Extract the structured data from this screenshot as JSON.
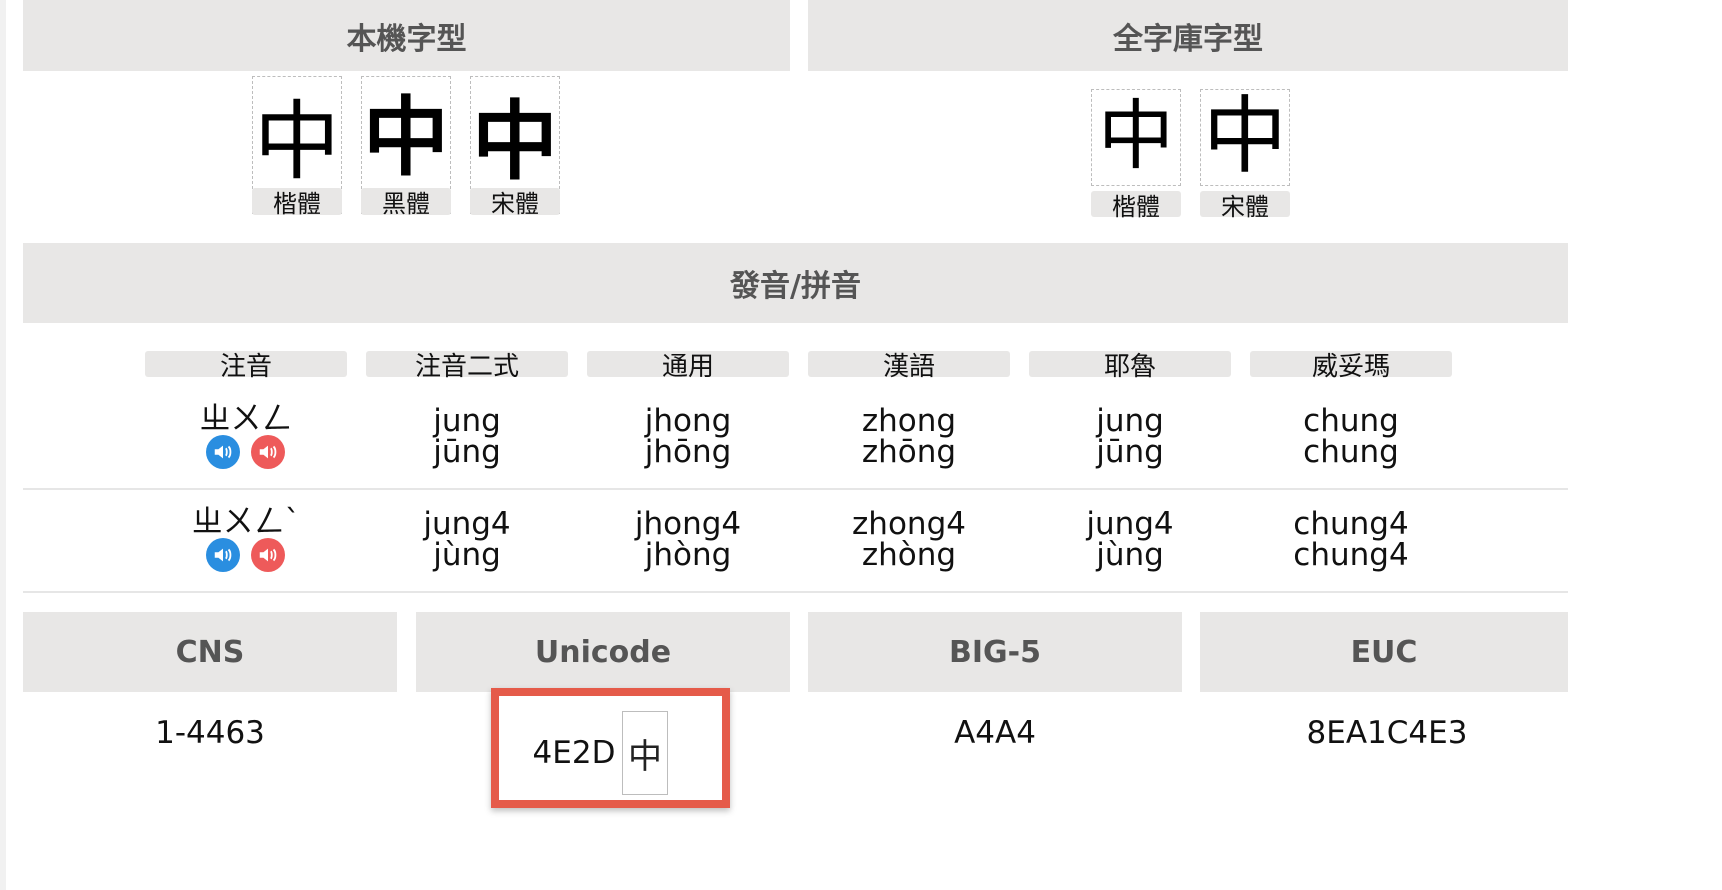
{
  "headers": {
    "local_fonts": "本機字型",
    "full_fonts": "全字庫字型",
    "pronunciation": "發音/拼音",
    "cns": "CNS",
    "unicode": "Unicode",
    "big5": "BIG-5",
    "euc": "EUC"
  },
  "character": "中",
  "local_font_labels": [
    "楷體",
    "黑體",
    "宋體"
  ],
  "full_font_labels": [
    "楷體",
    "宋體"
  ],
  "pinyin_columns": [
    "注音",
    "注音二式",
    "通用",
    "漢語",
    "耶魯",
    "威妥瑪"
  ],
  "readings": [
    {
      "zhuyin": "ㄓㄨㄥ",
      "cells": [
        [
          "jung",
          "jūng"
        ],
        [
          "jhong",
          "jhōng"
        ],
        [
          "zhong",
          "zhōng"
        ],
        [
          "jung",
          "jūng"
        ],
        [
          "chung",
          "chung"
        ]
      ]
    },
    {
      "zhuyin": "ㄓㄨㄥˋ",
      "cells": [
        [
          "jung4",
          "jùng"
        ],
        [
          "jhong4",
          "jhòng"
        ],
        [
          "zhong4",
          "zhòng"
        ],
        [
          "jung4",
          "jùng"
        ],
        [
          "chung4",
          "chung4"
        ]
      ]
    }
  ],
  "codes": {
    "cns": "1-4463",
    "unicode": "4E2D",
    "big5": "A4A4",
    "euc": "8EA1C4E3"
  },
  "icons": {
    "speaker_male": "speaker-icon",
    "speaker_female": "speaker-icon"
  },
  "colors": {
    "header_bg": "#e8e7e6",
    "speaker_blue": "#2a8ee0",
    "speaker_red": "#ee5a5a",
    "highlight": "#e55b4a"
  }
}
